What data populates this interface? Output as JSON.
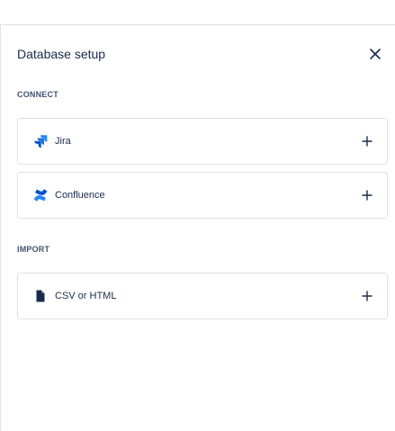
{
  "panel": {
    "title": "Database setup",
    "close_icon": "close-icon"
  },
  "sections": [
    {
      "label": "CONNECT",
      "items": [
        {
          "label": "Jira",
          "icon": "jira-icon",
          "action_icon": "plus-icon",
          "icon_color": "#2684ff"
        },
        {
          "label": "Confluence",
          "icon": "confluence-icon",
          "action_icon": "plus-icon",
          "icon_color": "#2684ff"
        }
      ]
    },
    {
      "label": "IMPORT",
      "items": [
        {
          "label": "CSV or HTML",
          "icon": "file-icon",
          "action_icon": "plus-icon",
          "icon_color": "#172b4d"
        }
      ]
    }
  ],
  "colors": {
    "text": "#172b4d",
    "section_label": "#42526e",
    "border": "#dfe1e6",
    "brand_blue": "#2684ff"
  }
}
